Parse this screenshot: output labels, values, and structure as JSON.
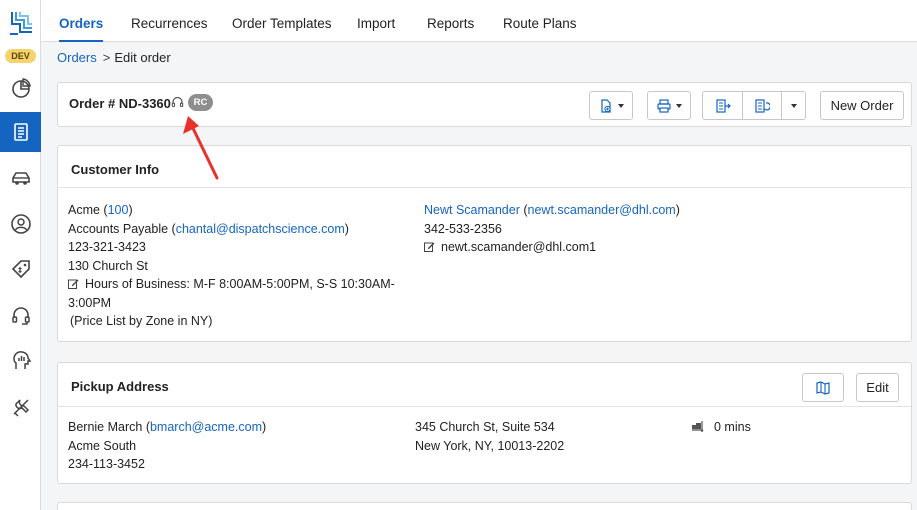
{
  "env_badge": "DEV",
  "sidebar": {
    "items": [
      {
        "icon": "analytics-icon",
        "active": false
      },
      {
        "icon": "orders-icon",
        "active": true
      },
      {
        "icon": "vehicle-icon",
        "active": false
      },
      {
        "icon": "user-icon",
        "active": false
      },
      {
        "icon": "price-tag-icon",
        "active": false
      },
      {
        "icon": "headset-icon",
        "active": false
      },
      {
        "icon": "reports-icon",
        "active": false
      },
      {
        "icon": "tools-icon",
        "active": false
      }
    ]
  },
  "tabs": [
    "Orders",
    "Recurrences",
    "Order Templates",
    "Import",
    "Reports",
    "Route Plans"
  ],
  "breadcrumb": {
    "root": "Orders",
    "sep": ">",
    "current": "Edit order"
  },
  "order": {
    "title": "Order # ND-3360",
    "badge": "RC",
    "new_order_label": "New Order"
  },
  "customer": {
    "title": "Customer Info",
    "company": "Acme",
    "company_id": "100",
    "billing_contact": "Accounts Payable",
    "billing_email": "chantal@dispatchscience.com",
    "phone": "123-321-3423",
    "address": "130 Church St",
    "hours_line1": "Hours of Business: M-F 8:00AM-5:00PM, S-S 10:30AM-",
    "hours_line2": "3:00PM",
    "price_list": "(Price List by Zone in NY)",
    "contact_name": "Newt Scamander",
    "contact_email": "newt.scamander@dhl.com",
    "contact_phone": "342-533-2356",
    "contact_note": "newt.scamander@dhl.com1"
  },
  "pickup": {
    "title": "Pickup Address",
    "edit_label": "Edit",
    "contact_name": "Bernie March",
    "contact_email": "bmarch@acme.com",
    "company": "Acme South",
    "phone": "234-113-3452",
    "address_line1": "345 Church St, Suite 534",
    "address_line2": "New York, NY, 10013-2202",
    "wait_time": "0 mins"
  },
  "colors": {
    "accent": "#1565c0",
    "annotation": "#e8312a",
    "dev_badge": "#f5d36c"
  }
}
